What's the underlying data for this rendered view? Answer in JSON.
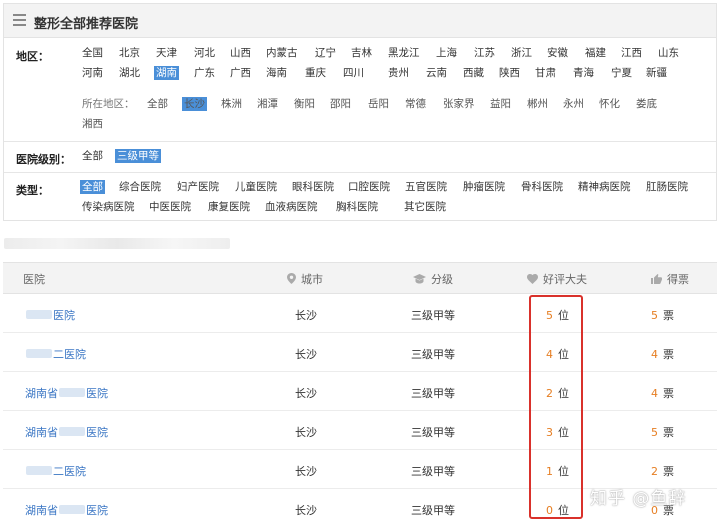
{
  "header": {
    "title": "整形全部推荐医院",
    "icon": "list-icon"
  },
  "region": {
    "label": "地区：",
    "provinces": [
      "全国",
      "北京",
      "天津",
      "河北",
      "山西",
      "内蒙古",
      "辽宁",
      "吉林",
      "黑龙江",
      "上海",
      "江苏",
      "浙江",
      "安徽",
      "福建",
      "江西",
      "山东",
      "河南",
      "湖北",
      "湖南",
      "广东",
      "广西",
      "海南",
      "重庆",
      "四川",
      "贵州",
      "云南",
      "西藏",
      "陕西",
      "甘肃",
      "青海",
      "宁夏",
      "新疆"
    ],
    "active_province": "湖南",
    "sub_label": "所在地区：",
    "cities": [
      "全部",
      "长沙",
      "株洲",
      "湘潭",
      "衡阳",
      "邵阳",
      "岳阳",
      "常德",
      "张家界",
      "益阳",
      "郴州",
      "永州",
      "怀化",
      "娄底",
      "湘西"
    ],
    "active_city": "长沙"
  },
  "level": {
    "label": "医院级别：",
    "options": [
      "全部",
      "三级甲等"
    ],
    "active": "三级甲等"
  },
  "type": {
    "label": "类型：",
    "options": [
      "全部",
      "综合医院",
      "妇产医院",
      "儿童医院",
      "眼科医院",
      "口腔医院",
      "五官医院",
      "肿瘤医院",
      "骨科医院",
      "精神病医院",
      "肛肠医院",
      "传染病医院",
      "中医医院",
      "康复医院",
      "血液病医院",
      "胸科医院",
      "其它医院"
    ],
    "active": "全部"
  },
  "table": {
    "columns": [
      {
        "label": "医院",
        "icon": ""
      },
      {
        "label": "城市",
        "icon": "location-pin-icon"
      },
      {
        "label": "分级",
        "icon": "graduation-cap-icon"
      },
      {
        "label": "好评大夫",
        "icon": "heart-icon"
      },
      {
        "label": "得票",
        "icon": "thumbs-up-icon"
      }
    ],
    "rows": [
      {
        "name_prefix": "",
        "name_suffix": "医院",
        "city": "长沙",
        "level": "三级甲等",
        "doctors": "5",
        "doctors_unit": "位",
        "votes": "5",
        "votes_unit": "票"
      },
      {
        "name_prefix": "",
        "name_suffix": "二医院",
        "city": "长沙",
        "level": "三级甲等",
        "doctors": "4",
        "doctors_unit": "位",
        "votes": "4",
        "votes_unit": "票"
      },
      {
        "name_prefix": "湖南省",
        "name_suffix": "医院",
        "city": "长沙",
        "level": "三级甲等",
        "doctors": "2",
        "doctors_unit": "位",
        "votes": "4",
        "votes_unit": "票"
      },
      {
        "name_prefix": "湖南省",
        "name_suffix": "医院",
        "city": "长沙",
        "level": "三级甲等",
        "doctors": "3",
        "doctors_unit": "位",
        "votes": "5",
        "votes_unit": "票"
      },
      {
        "name_prefix": "",
        "name_suffix": "二医院",
        "city": "长沙",
        "level": "三级甲等",
        "doctors": "1",
        "doctors_unit": "位",
        "votes": "2",
        "votes_unit": "票"
      },
      {
        "name_prefix": "湖南省",
        "name_suffix": "医院",
        "city": "长沙",
        "level": "三级甲等",
        "doctors": "0",
        "doctors_unit": "位",
        "votes": "0",
        "votes_unit": "票"
      }
    ]
  },
  "annotation": {
    "color": "#d9312b"
  },
  "watermark": "知乎 @鱼辞",
  "colors": {
    "accent": "#4a8fd8",
    "link": "#3a76c4",
    "number": "#e67e22"
  }
}
